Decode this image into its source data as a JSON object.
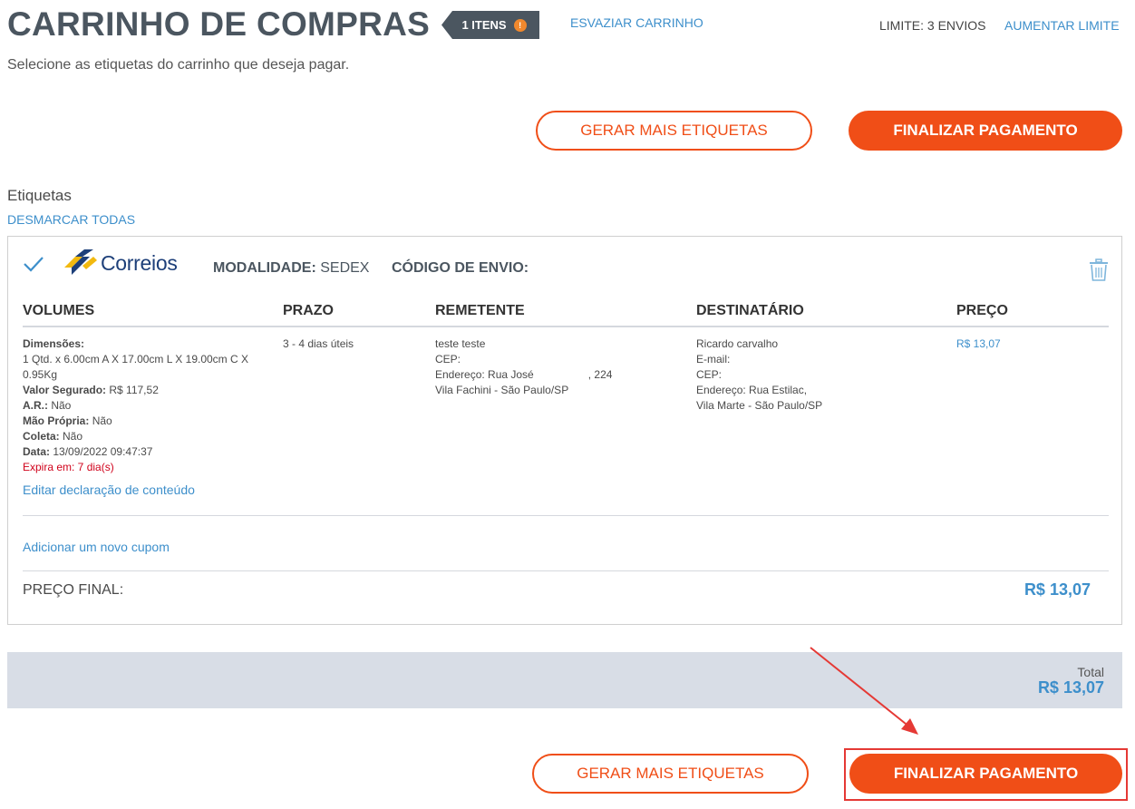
{
  "header": {
    "title": "CARRINHO DE COMPRAS",
    "items_badge": "1 ITENS",
    "badge_count": "!",
    "empty_cart": "ESVAZIAR CARRINHO",
    "limit_text": "LIMITE: 3 ENVIOS",
    "raise_limit": "AUMENTAR LIMITE",
    "subtitle": "Selecione as etiquetas do carrinho que deseja pagar."
  },
  "actions": {
    "more_labels": "GERAR MAIS ETIQUETAS",
    "pay": "FINALIZAR PAGAMENTO"
  },
  "labels_section": {
    "heading": "Etiquetas",
    "uncheck_all": "DESMARCAR TODAS"
  },
  "card": {
    "carrier": "Correios",
    "modalidade_label": "MODALIDADE:",
    "modalidade_value": "SEDEX",
    "codigo_label": "CÓDIGO DE ENVIO:",
    "columns": [
      "VOLUMES",
      "PRAZO",
      "REMETENTE",
      "DESTINATÁRIO",
      "PREÇO"
    ],
    "volumes": {
      "dimensoes_label": "Dimensões:",
      "dimensoes_line1": "1 Qtd. x 6.00cm A X 17.00cm L X 19.00cm C X",
      "dimensoes_line2": "0.95Kg",
      "valor_label": "Valor Segurado:",
      "valor_value": "R$ 117,52",
      "ar_label": "A.R.:",
      "ar_value": "Não",
      "mao_label": "Mão Própria:",
      "mao_value": "Não",
      "coleta_label": "Coleta:",
      "coleta_value": "Não",
      "data_label": "Data:",
      "data_value": "13/09/2022 09:47:37",
      "expira": "Expira em: 7 dia(s)"
    },
    "prazo": "3 - 4 dias úteis",
    "remetente": {
      "name": "teste teste",
      "cep": "CEP:",
      "endereco": "Endereço: Rua José",
      "numero": ", 224",
      "bairro": "Vila Fachini - São Paulo/SP"
    },
    "destinatario": {
      "name": "Ricardo carvalho",
      "email": "E-mail:",
      "cep": "CEP:",
      "endereco": "Endereço: Rua Estilac,",
      "bairro": "Vila Marte - São Paulo/SP"
    },
    "preco": "R$ 13,07",
    "edit_declaration": "Editar declaração de conteúdo",
    "add_coupon": "Adicionar um novo cupom",
    "final_price_label": "PREÇO FINAL:",
    "final_price_value": "R$ 13,07"
  },
  "total": {
    "label": "Total",
    "value": "R$ 13,07"
  },
  "colors": {
    "accent_orange": "#f04e17",
    "link_blue": "#3d8fcb",
    "title_dark": "#4b5660",
    "annotation_red": "#e53935",
    "total_bar": "#d8dde6"
  },
  "icons": {
    "check": "check-icon",
    "trash": "trash-icon",
    "logo": "correios-logo",
    "arrow": "annotation-arrow"
  }
}
